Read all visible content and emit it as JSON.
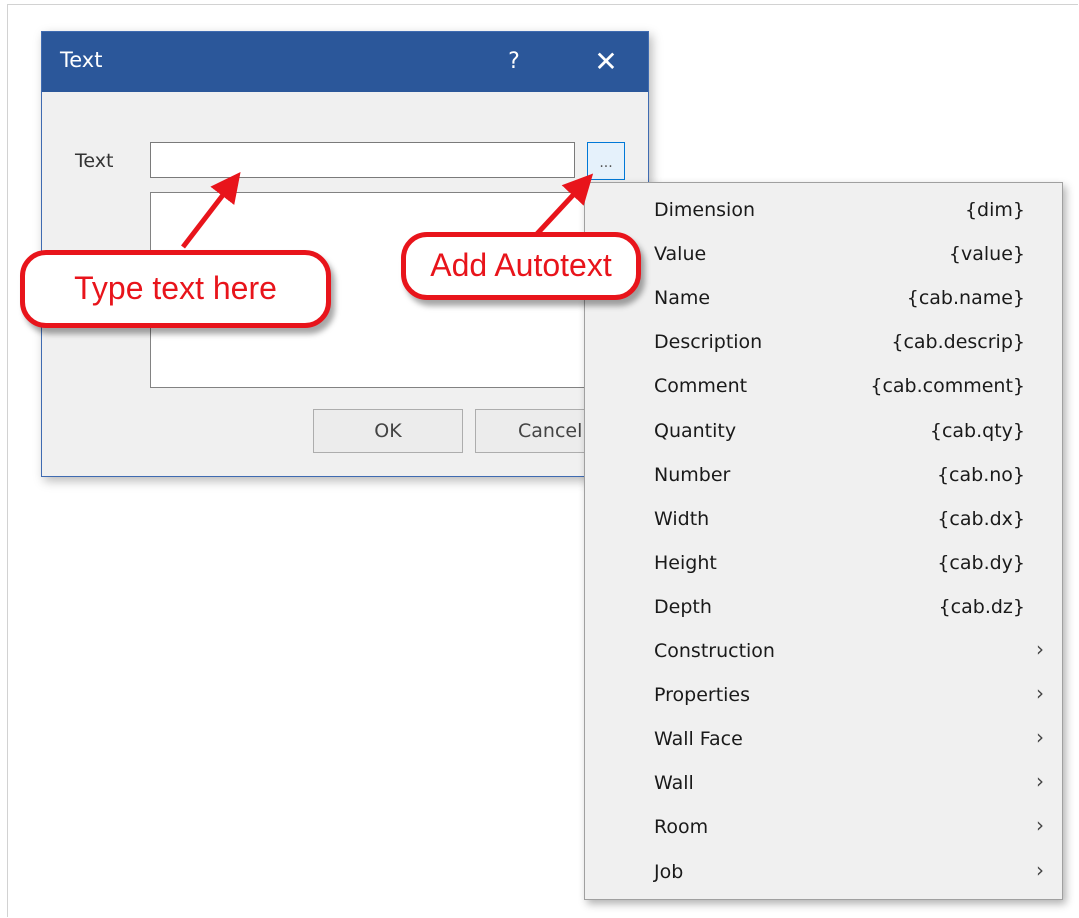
{
  "dialog": {
    "title": "Text",
    "help_label": "?",
    "close_label": "✕",
    "field_label": "Text",
    "text_value": "",
    "text_placeholder": "",
    "autotext_button_label": "...",
    "ok_label": "OK",
    "cancel_label": "Cancel"
  },
  "annotations": {
    "type_text": "Type text here",
    "add_autotext": "Add Autotext",
    "color": "#e8141b"
  },
  "menu": {
    "items": [
      {
        "label": "Dimension",
        "code": "{dim}",
        "submenu": false
      },
      {
        "label": "Value",
        "code": "{value}",
        "submenu": false
      },
      {
        "label": "Name",
        "code": "{cab.name}",
        "submenu": false
      },
      {
        "label": "Description",
        "code": "{cab.descrip}",
        "submenu": false
      },
      {
        "label": "Comment",
        "code": "{cab.comment}",
        "submenu": false
      },
      {
        "label": "Quantity",
        "code": "{cab.qty}",
        "submenu": false
      },
      {
        "label": "Number",
        "code": "{cab.no}",
        "submenu": false
      },
      {
        "label": "Width",
        "code": "{cab.dx}",
        "submenu": false
      },
      {
        "label": "Height",
        "code": "{cab.dy}",
        "submenu": false
      },
      {
        "label": "Depth",
        "code": "{cab.dz}",
        "submenu": false
      },
      {
        "label": "Construction",
        "code": "",
        "submenu": true
      },
      {
        "label": "Properties",
        "code": "",
        "submenu": true
      },
      {
        "label": "Wall Face",
        "code": "",
        "submenu": true
      },
      {
        "label": "Wall",
        "code": "",
        "submenu": true
      },
      {
        "label": "Room",
        "code": "",
        "submenu": true
      },
      {
        "label": "Job",
        "code": "",
        "submenu": true
      }
    ],
    "submenu_arrow": "›"
  },
  "colors": {
    "titlebar": "#2b579a",
    "dialog_bg": "#f0f0f0",
    "menu_bg": "#f0f0f0",
    "accent_border": "#0078d7"
  }
}
